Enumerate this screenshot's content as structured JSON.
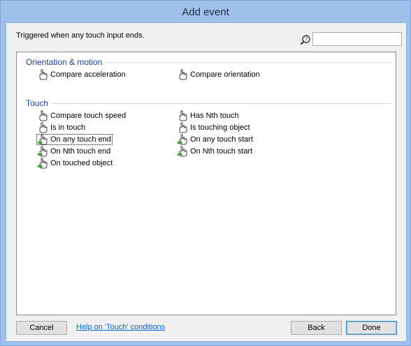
{
  "window": {
    "title": "Add event"
  },
  "description": "Triggered when any touch input ends.",
  "search": {
    "value": "",
    "placeholder": ""
  },
  "icons": {
    "search": "search-help-icon",
    "condition": "hand-pointer-icon",
    "trigger": "hand-pointer-trigger-icon"
  },
  "groups": [
    {
      "header": "Orientation & motion",
      "items": [
        {
          "label": "Compare acceleration",
          "kind": "condition"
        },
        {
          "label": "Compare orientation",
          "kind": "condition"
        }
      ]
    },
    {
      "header": "Touch",
      "items": [
        {
          "label": "Compare touch speed",
          "kind": "condition"
        },
        {
          "label": "Has Nth touch",
          "kind": "condition"
        },
        {
          "label": "Is in touch",
          "kind": "condition"
        },
        {
          "label": "Is touching object",
          "kind": "condition"
        },
        {
          "label": "On any touch end",
          "kind": "trigger",
          "selected": true
        },
        {
          "label": "On any touch start",
          "kind": "trigger"
        },
        {
          "label": "On Nth touch end",
          "kind": "trigger"
        },
        {
          "label": "On Nth touch start",
          "kind": "trigger"
        },
        {
          "label": "On touched object",
          "kind": "trigger"
        }
      ]
    }
  ],
  "footer": {
    "cancel": "Cancel",
    "help_link": "Help on 'Touch' conditions",
    "back": "Back",
    "done": "Done"
  },
  "colors": {
    "titlebar": "#9dc1ea",
    "group_header": "#1e3f8a",
    "link": "#0066cc",
    "trigger_arrow": "#3aa13a"
  }
}
